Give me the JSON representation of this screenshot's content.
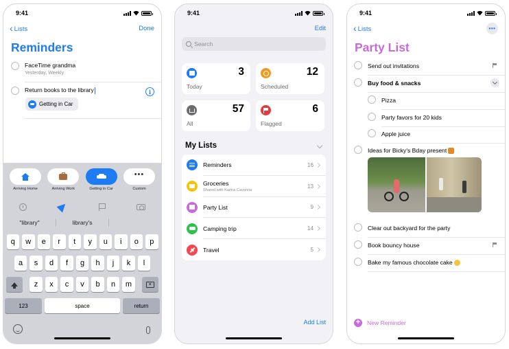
{
  "status": {
    "time": "9:41"
  },
  "screen1": {
    "back_label": "Lists",
    "done_label": "Done",
    "title": "Reminders",
    "title_color": "#1d7cf2",
    "items": [
      {
        "title": "FaceTime grandma",
        "subtitle": "Yesterday, Weekly"
      },
      {
        "title": "Return books to the library"
      }
    ],
    "chip_label": "Getting in Car",
    "locations": [
      {
        "label": "Arriving Home",
        "icon": "house-icon"
      },
      {
        "label": "Arriving Work",
        "icon": "briefcase-icon"
      },
      {
        "label": "Getting in Car",
        "icon": "car-icon",
        "selected": true
      },
      {
        "label": "Custom",
        "icon": "ellipsis-icon"
      }
    ],
    "toolbar_icons": [
      "clock-icon",
      "location-arrow-icon",
      "flag-icon",
      "camera-icon"
    ],
    "suggestions": [
      "\"library\"",
      "library's",
      ""
    ],
    "keyboard": {
      "row1": [
        "q",
        "w",
        "e",
        "r",
        "t",
        "y",
        "u",
        "i",
        "o",
        "p"
      ],
      "row2": [
        "a",
        "s",
        "d",
        "f",
        "g",
        "h",
        "j",
        "k",
        "l"
      ],
      "row3": [
        "z",
        "x",
        "c",
        "v",
        "b",
        "n",
        "m"
      ],
      "numbers": "123",
      "space": "space",
      "return": "return"
    }
  },
  "screen2": {
    "edit_label": "Edit",
    "search_placeholder": "Search",
    "cards": [
      {
        "label": "Today",
        "count": "3",
        "color": "#1d7cf2",
        "icon": "calendar-icon"
      },
      {
        "label": "Scheduled",
        "count": "12",
        "color": "#f29a1b",
        "icon": "clock-icon"
      },
      {
        "label": "All",
        "count": "57",
        "color": "#6b6b70",
        "icon": "tray-icon"
      },
      {
        "label": "Flagged",
        "count": "6",
        "color": "#e5393e",
        "icon": "flag-icon"
      }
    ],
    "my_lists_header": "My Lists",
    "lists": [
      {
        "name": "Reminders",
        "count": "16",
        "color": "#1d7cf2",
        "icon": "list-icon"
      },
      {
        "name": "Groceries",
        "shared": "Shared with Karina Cavanna",
        "count": "13",
        "color": "#f2c511",
        "icon": "bag-icon"
      },
      {
        "name": "Party List",
        "count": "9",
        "color": "#c76bd9",
        "icon": "gift-icon"
      },
      {
        "name": "Camping trip",
        "count": "14",
        "color": "#2cc24a",
        "icon": "car-icon"
      },
      {
        "name": "Travel",
        "count": "5",
        "color": "#f24852",
        "icon": "airplane-icon"
      }
    ],
    "add_list_label": "Add List"
  },
  "screen3": {
    "back_label": "Lists",
    "title": "Party List",
    "title_color": "#c76bd9",
    "items": [
      {
        "text": "Send out invitations",
        "flag": true
      },
      {
        "text": "Buy food & snacks",
        "bold": true,
        "expand": true
      },
      {
        "text": "Pizza",
        "sub": true
      },
      {
        "text": "Party favors for 20 kids",
        "sub": true
      },
      {
        "text": "Apple juice",
        "sub": true
      },
      {
        "text": "Ideas for Bicky's Bday present",
        "emoji": "gift"
      },
      {
        "text": "Clear out backyard for the party"
      },
      {
        "text": "Book bouncy house",
        "flag": true
      },
      {
        "text": "Bake my famous chocolate cake",
        "emoji": "face"
      }
    ],
    "new_reminder_label": "New Reminder"
  }
}
